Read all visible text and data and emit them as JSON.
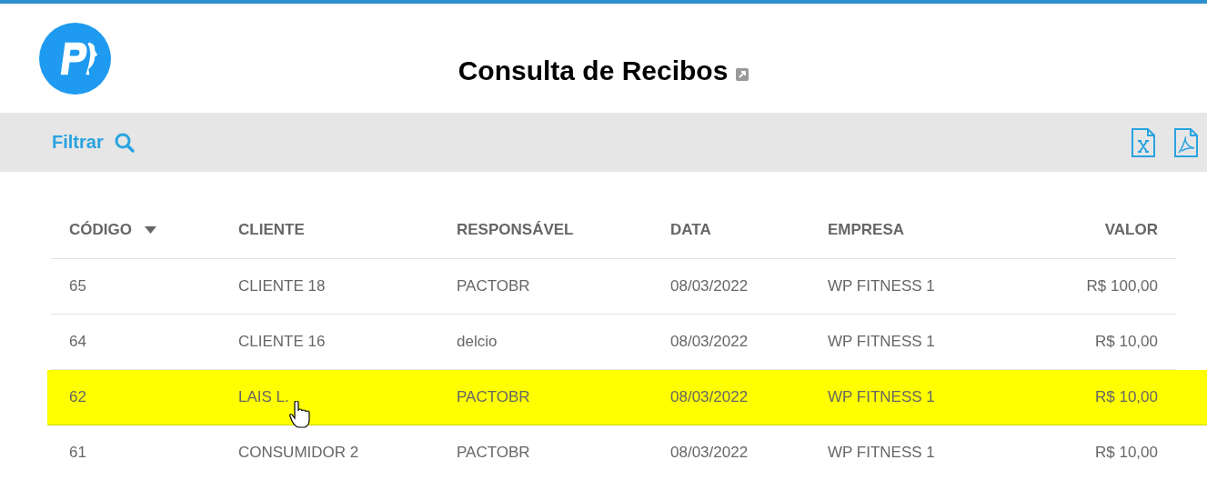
{
  "page": {
    "title": "Consulta de Recibos"
  },
  "toolbar": {
    "filter_label": "Filtrar"
  },
  "table": {
    "columns": [
      {
        "label": "CÓDIGO",
        "sorted": true
      },
      {
        "label": "CLIENTE",
        "sorted": false
      },
      {
        "label": "RESPONSÁVEL",
        "sorted": false
      },
      {
        "label": "DATA",
        "sorted": false
      },
      {
        "label": "EMPRESA",
        "sorted": false
      },
      {
        "label": "VALOR",
        "sorted": false
      }
    ],
    "rows": [
      {
        "cells": [
          "65",
          "CLIENTE 18",
          "PACTOBR",
          "08/03/2022",
          "WP FITNESS 1",
          "R$ 100,00"
        ],
        "selected": false
      },
      {
        "cells": [
          "64",
          "CLIENTE 16",
          "delcio",
          "08/03/2022",
          "WP FITNESS 1",
          "R$ 10,00"
        ],
        "selected": false
      },
      {
        "cells": [
          "62",
          "LAIS L.",
          "PACTOBR",
          "08/03/2022",
          "WP FITNESS 1",
          "R$ 10,00"
        ],
        "selected": true
      },
      {
        "cells": [
          "61",
          "CONSUMIDOR 2",
          "PACTOBR",
          "08/03/2022",
          "WP FITNESS 1",
          "R$ 10,00"
        ],
        "selected": false
      }
    ]
  }
}
